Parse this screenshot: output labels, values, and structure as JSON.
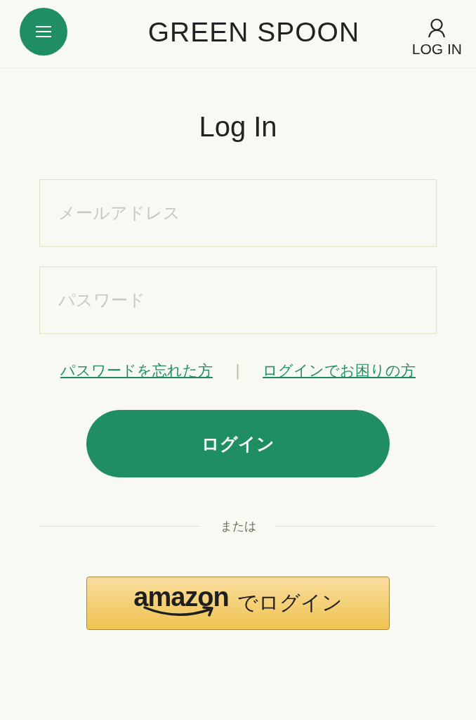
{
  "header": {
    "logo": "GREEN SPOON",
    "login_label": "LOG IN"
  },
  "title": "Log In",
  "fields": [
    {
      "placeholder": "メールアドレス"
    },
    {
      "placeholder": "パスワード"
    }
  ],
  "links": [
    "パスワードを忘れた方",
    "ログインでお困りの方"
  ],
  "separator": "|",
  "login_button": "ログイン",
  "divider_text": "または",
  "amazon_button": {
    "brand": "amazon",
    "label": "でログイン"
  }
}
